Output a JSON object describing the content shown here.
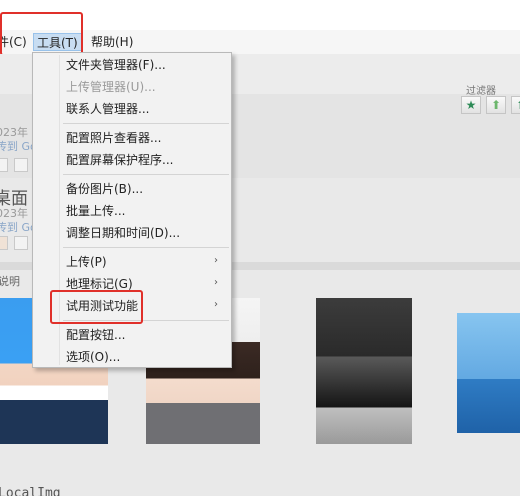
{
  "menubar": {
    "file": "件(C)",
    "tools": "工具(T)",
    "help": "帮助(H)"
  },
  "filter": {
    "label": "过滤器",
    "star": "★",
    "up": "⬆",
    "up2": "⬆"
  },
  "folders": [
    {
      "name": "",
      "date": "023年",
      "link": "传到 Go"
    },
    {
      "name": "桌面",
      "date": "023年",
      "link": "传到 Go"
    }
  ],
  "description_label": "说明",
  "bottom_label": "LocalImg",
  "tools_menu": {
    "items": [
      {
        "label": "文件夹管理器(F)...",
        "enabled": true
      },
      {
        "label": "上传管理器(U)...",
        "enabled": false
      },
      {
        "label": "联系人管理器...",
        "enabled": true
      },
      {
        "label": "配置照片查看器...",
        "enabled": true
      },
      {
        "label": "配置屏幕保护程序...",
        "enabled": true
      },
      {
        "label": "备份图片(B)...",
        "enabled": true
      },
      {
        "label": "批量上传...",
        "enabled": true
      },
      {
        "label": "调整日期和时间(D)...",
        "enabled": true
      },
      {
        "label": "上传(P)",
        "enabled": true,
        "submenu": true
      },
      {
        "label": "地理标记(G)",
        "enabled": true,
        "submenu": true
      },
      {
        "label": "试用测试功能",
        "enabled": true,
        "submenu": true
      },
      {
        "label": "配置按钮...",
        "enabled": true
      },
      {
        "label": "选项(O)...",
        "enabled": true
      }
    ],
    "submenu_arrow": "›"
  },
  "colors": {
    "highlight_box": "#e0302a",
    "menu_selected": "#c8ddf2"
  }
}
